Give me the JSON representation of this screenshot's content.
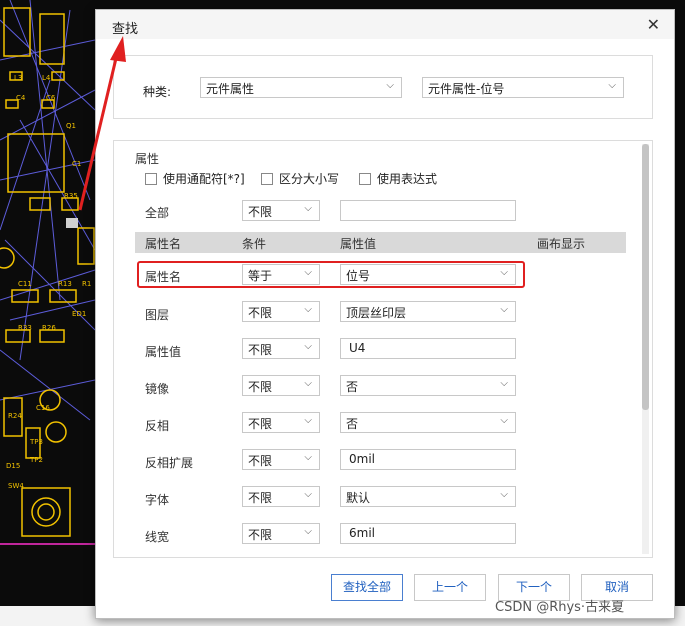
{
  "pcb": {
    "labels": [
      "L3",
      "L4",
      "C4",
      "C6",
      "Q1",
      "C1",
      "R35",
      "R13",
      "R1",
      "C11",
      "ED1",
      "R33",
      "R26",
      "R24",
      "C16",
      "D15",
      "TP3",
      "TP2",
      "SW4"
    ]
  },
  "dialog": {
    "title": "查找",
    "type_label": "种类:",
    "type_select": "元件属性",
    "subtype_select": "元件属性-位号",
    "section_title": "属性",
    "checkboxes": [
      "使用通配符[*?]",
      "区分大小写",
      "使用表达式"
    ],
    "all_label": "全部",
    "all_condition": "不限",
    "all_value": "",
    "headers": {
      "name": "属性名",
      "condition": "条件",
      "value": "属性值",
      "canvas": "画布显示"
    },
    "rows": [
      {
        "name": "属性名",
        "condition": "等于",
        "value": "位号"
      },
      {
        "name": "图层",
        "condition": "不限",
        "value": "顶层丝印层"
      },
      {
        "name": "属性值",
        "condition": "不限",
        "value": "U4"
      },
      {
        "name": "镜像",
        "condition": "不限",
        "value": "否"
      },
      {
        "name": "反相",
        "condition": "不限",
        "value": "否"
      },
      {
        "name": "反相扩展",
        "condition": "不限",
        "value": "0mil"
      },
      {
        "name": "字体",
        "condition": "不限",
        "value": "默认"
      },
      {
        "name": "线宽",
        "condition": "不限",
        "value": "6mil"
      }
    ],
    "buttons": {
      "find_all": "查找全部",
      "prev": "上一个",
      "next": "下一个",
      "cancel": "取消"
    }
  },
  "watermark": "CSDN @Rhys·古来夏",
  "colors": {
    "pcb_bg": "#0b0b0b",
    "pcb_trace": "#6b6bff",
    "pcb_silk": "#f2c200",
    "highlight": "#e02020",
    "link_text": "#1f5fbf"
  }
}
